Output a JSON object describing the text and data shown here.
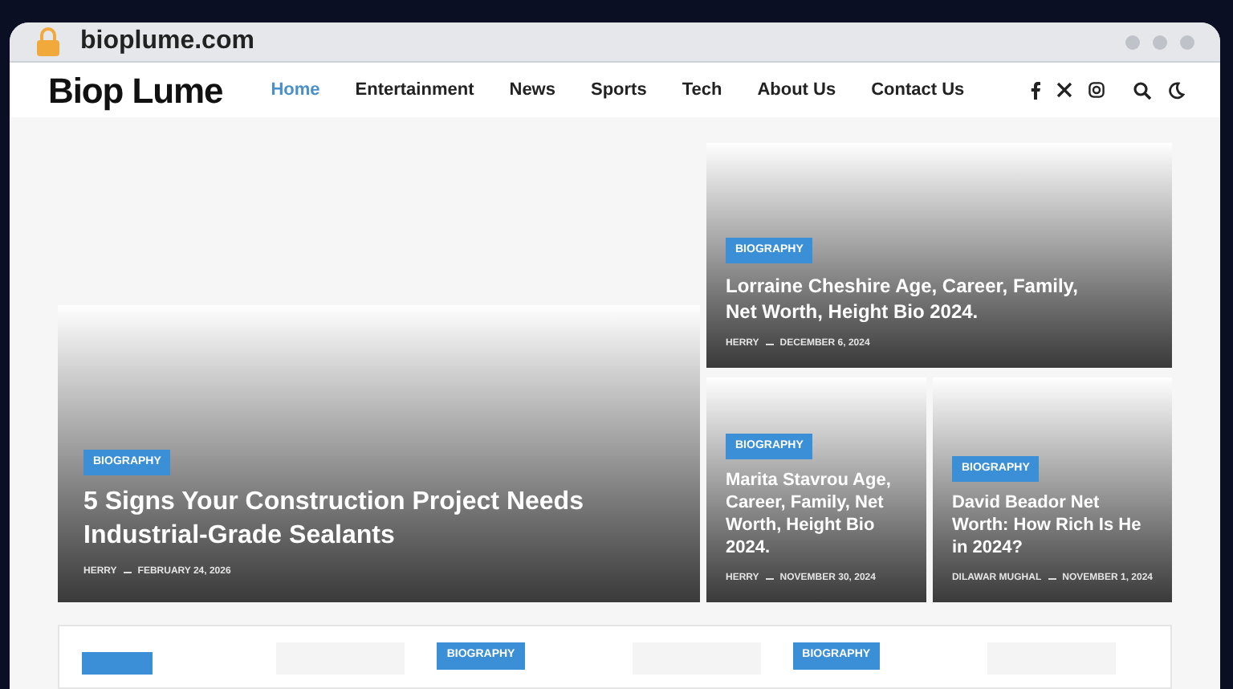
{
  "browser": {
    "url": "bioplume.com"
  },
  "site": {
    "logo": "Biop Lume",
    "nav": [
      {
        "label": "Home",
        "selected": true
      },
      {
        "label": "Entertainment",
        "selected": false
      },
      {
        "label": "News",
        "selected": false
      },
      {
        "label": "Sports",
        "selected": false
      },
      {
        "label": "Tech",
        "selected": false
      },
      {
        "label": "About Us",
        "selected": false
      },
      {
        "label": "Contact Us",
        "selected": false
      }
    ]
  },
  "featured": [
    {
      "category": "BIOGRAPHY",
      "title": "5 Signs Your Construction Project Needs Industrial-Grade Sealants",
      "author": "HERRY",
      "date": "FEBRUARY 24, 2026"
    },
    {
      "category": "BIOGRAPHY",
      "title": "Lorraine Cheshire Age, Career, Family, Net Worth, Height Bio 2024.",
      "author": "HERRY",
      "date": "DECEMBER 6, 2024"
    },
    {
      "category": "BIOGRAPHY",
      "title": "Marita Stavrou Age, Career, Family, Net Worth, Height Bio 2024.",
      "author": "HERRY",
      "date": "NOVEMBER 30, 2024"
    },
    {
      "category": "BIOGRAPHY",
      "title": "David Beador Net Worth: How Rich Is He in 2024?",
      "author": "DILAWAR MUGHAL",
      "date": "NOVEMBER 1, 2024"
    }
  ],
  "more": [
    {
      "kind": "covered"
    },
    {
      "kind": "badge",
      "category": "BIOGRAPHY"
    },
    {
      "kind": "badge",
      "category": "BIOGRAPHY"
    }
  ]
}
